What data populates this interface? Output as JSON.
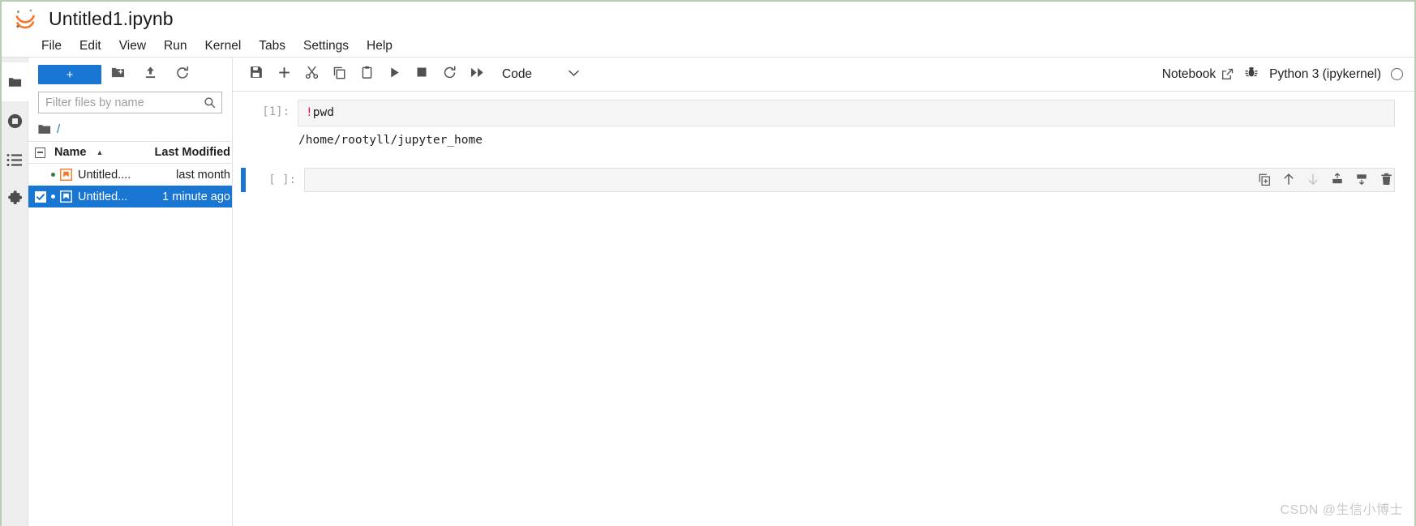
{
  "window": {
    "title": "Untitled1.ipynb",
    "logo_icon": "jupyter-logo-icon"
  },
  "menubar": {
    "items": [
      {
        "label": "File"
      },
      {
        "label": "Edit"
      },
      {
        "label": "View"
      },
      {
        "label": "Run"
      },
      {
        "label": "Kernel"
      },
      {
        "label": "Tabs"
      },
      {
        "label": "Settings"
      },
      {
        "label": "Help"
      }
    ]
  },
  "activitybar": {
    "items": [
      {
        "name": "file-browser",
        "icon": "folder-icon",
        "active": true
      },
      {
        "name": "running-sessions",
        "icon": "stop-circle-icon",
        "active": false
      },
      {
        "name": "commands",
        "icon": "list-icon",
        "active": false
      },
      {
        "name": "extension-manager",
        "icon": "puzzle-icon",
        "active": false
      }
    ]
  },
  "filebrowser": {
    "toolbar": {
      "new_launcher_label": "+",
      "new_folder_icon": "new-folder-icon",
      "upload_icon": "upload-icon",
      "refresh_icon": "refresh-icon"
    },
    "filter": {
      "placeholder": "Filter files by name",
      "value": "",
      "icon": "search-icon"
    },
    "breadcrumb": {
      "root_icon": "folder-icon",
      "path": "/"
    },
    "columns": {
      "name": "Name",
      "last_modified": "Last Modified",
      "sort_indicator": "▲"
    },
    "files": [
      {
        "name": "Untitled....",
        "last_modified": "last month",
        "selected": false,
        "unsaved": true,
        "icon": "notebook-icon"
      },
      {
        "name": "Untitled...",
        "last_modified": "1 minute ago",
        "selected": true,
        "unsaved": true,
        "icon": "notebook-icon"
      }
    ]
  },
  "notebook": {
    "toolbar": {
      "buttons": [
        {
          "name": "save-button",
          "icon": "save-icon"
        },
        {
          "name": "insert-cell-button",
          "icon": "plus-icon"
        },
        {
          "name": "cut-cells-button",
          "icon": "scissors-icon"
        },
        {
          "name": "copy-cells-button",
          "icon": "copy-icon"
        },
        {
          "name": "paste-cells-button",
          "icon": "paste-icon"
        },
        {
          "name": "run-cell-button",
          "icon": "play-icon"
        },
        {
          "name": "interrupt-kernel-button",
          "icon": "stop-icon"
        },
        {
          "name": "restart-kernel-button",
          "icon": "restart-icon"
        },
        {
          "name": "restart-run-all-button",
          "icon": "fast-forward-icon"
        }
      ],
      "cell_type": "Code",
      "cell_type_chevron": "⌄",
      "mode_label": "Notebook",
      "mode_external_icon": "external-link-icon",
      "debugger_icon": "bug-icon",
      "kernel_name": "Python 3 (ipykernel)",
      "kernel_status": "idle"
    },
    "cells": [
      {
        "prompt": "[1]:",
        "source_prefix": "!",
        "source": "pwd",
        "output": "/home/rootyll/jupyter_home",
        "active": false
      },
      {
        "prompt": "[ ]:",
        "source_prefix": "",
        "source": "",
        "output": "",
        "active": true
      }
    ],
    "cell_actions": [
      {
        "name": "duplicate-cell-button",
        "icon": "duplicate-icon",
        "enabled": true
      },
      {
        "name": "move-cell-up-button",
        "icon": "arrow-up-icon",
        "enabled": true
      },
      {
        "name": "move-cell-down-button",
        "icon": "arrow-down-icon",
        "enabled": false
      },
      {
        "name": "insert-cell-above-button",
        "icon": "insert-above-icon",
        "enabled": true
      },
      {
        "name": "insert-cell-below-button",
        "icon": "insert-below-icon",
        "enabled": true
      },
      {
        "name": "delete-cell-button",
        "icon": "trash-icon",
        "enabled": true
      }
    ]
  },
  "watermark": {
    "text": "CSDN @生信小博士"
  },
  "colors": {
    "accent": "#1976d2",
    "jupyter_orange": "#f37726",
    "toolbar_icon": "#515151",
    "input_bg": "#f5f5f5"
  }
}
